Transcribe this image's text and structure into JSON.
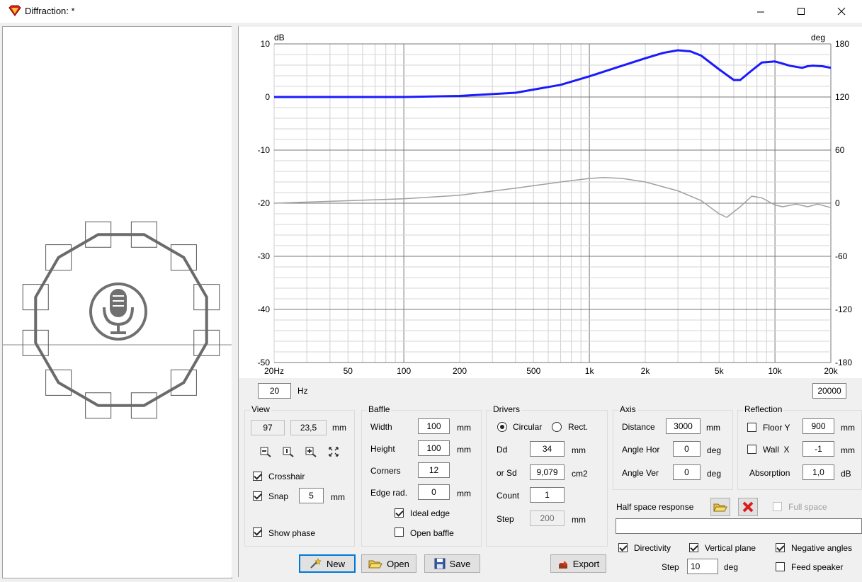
{
  "window": {
    "title": "Diffraction: *"
  },
  "chart_data": {
    "type": "line",
    "xlabel": "Hz",
    "ylabel": "dB",
    "y2label": "deg",
    "x_scale": "log",
    "xlim": [
      20,
      20000
    ],
    "ylim": [
      -50,
      10
    ],
    "y2lim": [
      -180,
      180
    ],
    "x_ticks": [
      "20Hz",
      "50",
      "100",
      "200",
      "500",
      "1k",
      "2k",
      "5k",
      "10k",
      "20k"
    ],
    "y_ticks": [
      "10",
      "0",
      "-10",
      "-20",
      "-30",
      "-40",
      "-50"
    ],
    "y2_ticks": [
      "180",
      "120",
      "60",
      "0",
      "-60",
      "-120",
      "-180"
    ],
    "series": [
      {
        "color": "#1a1aff",
        "axis": "left",
        "x": [
          20,
          100,
          200,
          400,
          700,
          1000,
          1500,
          2000,
          2500,
          3000,
          3500,
          4000,
          5000,
          6000,
          6500,
          7500,
          8500,
          10000,
          11000,
          12000,
          14000,
          15000,
          16000,
          18000,
          20000
        ],
        "y": [
          0,
          0,
          0.2,
          0.8,
          2.3,
          3.9,
          5.9,
          7.3,
          8.3,
          8.8,
          8.6,
          7.8,
          5.2,
          3.2,
          3.2,
          5.0,
          6.5,
          6.7,
          6.3,
          5.9,
          5.5,
          5.8,
          5.9,
          5.8,
          5.5
        ]
      },
      {
        "color": "#a0a0a0",
        "axis": "right",
        "x": [
          20,
          100,
          200,
          400,
          700,
          1000,
          1200,
          1500,
          2000,
          3000,
          4000,
          5000,
          5500,
          6500,
          7500,
          8500,
          10000,
          11000,
          13000,
          15000,
          17000,
          20000
        ],
        "y": [
          0,
          5,
          9,
          17,
          24,
          28,
          29,
          28,
          24,
          14,
          3,
          -12,
          -16,
          -4,
          8,
          6,
          -2,
          -4,
          -1,
          -4,
          -1,
          -5
        ]
      }
    ]
  },
  "range": {
    "min": "20",
    "unit": "Hz",
    "max": "20000"
  },
  "view": {
    "title": "View",
    "x": "97",
    "y": "23,5",
    "unit": "mm",
    "crosshair": "Crosshair",
    "snap": "Snap",
    "snap_value": "5",
    "snap_unit": "mm",
    "show_phase": "Show phase"
  },
  "baffle": {
    "title": "Baffle",
    "width_label": "Width",
    "width": "100",
    "height_label": "Height",
    "height": "100",
    "corners_label": "Corners",
    "corners": "12",
    "edge_label": "Edge rad.",
    "edge": "0",
    "unit": "mm",
    "ideal_edge": "Ideal edge",
    "open_baffle": "Open baffle"
  },
  "drivers": {
    "title": "Drivers",
    "circular": "Circular",
    "rect": "Rect.",
    "dd_label": "Dd",
    "dd": "34",
    "dd_unit": "mm",
    "sd_label": "or Sd",
    "sd": "9,079",
    "sd_unit": "cm2",
    "count_label": "Count",
    "count": "1",
    "step_label": "Step",
    "step": "200",
    "step_unit": "mm"
  },
  "axis": {
    "title": "Axis",
    "distance_label": "Distance",
    "distance": "3000",
    "distance_unit": "mm",
    "hor_label": "Angle Hor",
    "hor": "0",
    "ver_label": "Angle Ver",
    "ver": "0",
    "deg": "deg"
  },
  "reflection": {
    "title": "Reflection",
    "floor_label": "Floor Y",
    "floor": "900",
    "wall_label": "Wall  X",
    "wall": "-1",
    "unit": "mm",
    "absorption_label": "Absorption",
    "absorption": "1,0",
    "absorption_unit": "dB"
  },
  "half_space": {
    "label": "Half space response",
    "full_space": "Full space"
  },
  "directivity": {
    "directivity": "Directivity",
    "vertical_plane": "Vertical plane",
    "negative_angles": "Negative angles",
    "step_label": "Step",
    "step": "10",
    "step_unit": "deg",
    "feed_speaker": "Feed speaker"
  },
  "buttons": {
    "new": "New",
    "open": "Open",
    "save": "Save",
    "export": "Export"
  }
}
